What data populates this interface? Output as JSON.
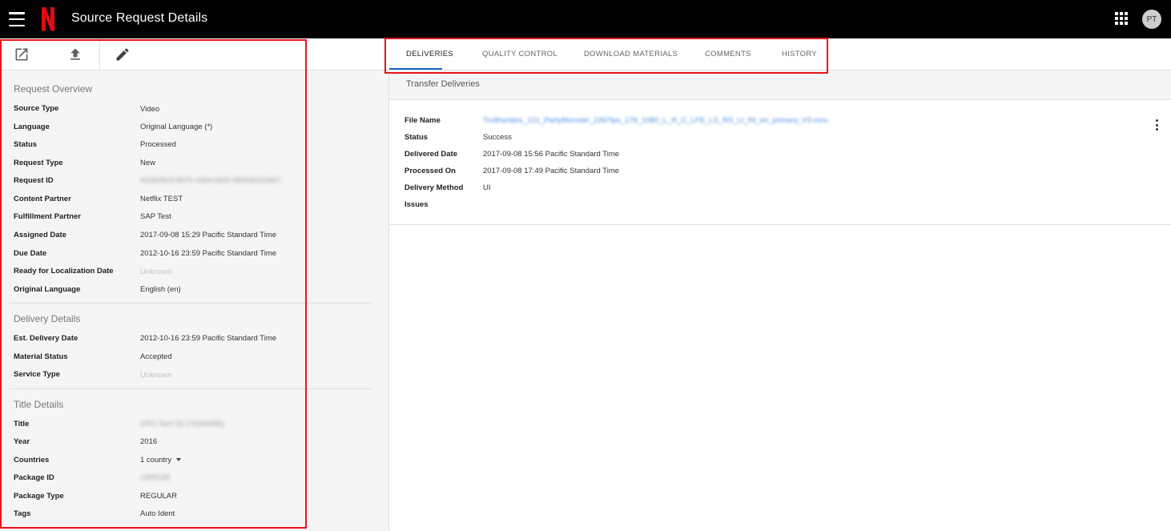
{
  "header": {
    "title": "Source Request Details",
    "avatar_initials": "PT",
    "brand_color": "#e50914",
    "menu_icon": "hamburger-menu-icon",
    "apps_icon": "apps-grid-icon"
  },
  "toolbar": {
    "icons": [
      "open-in-new-icon",
      "upload-icon",
      "edit-pencil-icon"
    ]
  },
  "request_overview": {
    "title": "Request Overview",
    "fields": [
      {
        "label": "Source Type",
        "value": "Video"
      },
      {
        "label": "Language",
        "value": "Original Language (*)"
      },
      {
        "label": "Status",
        "value": "Processed"
      },
      {
        "label": "Request Type",
        "value": "New"
      },
      {
        "label": "Request ID",
        "value": "415628c5-6670-436e-bfc5-0830d521fa57"
      },
      {
        "label": "Content Partner",
        "value": "Netflix TEST"
      },
      {
        "label": "Fulfillment Partner",
        "value": "SAP Test"
      },
      {
        "label": "Assigned Date",
        "value": "2017-09-08 15:29 Pacific Standard Time"
      },
      {
        "label": "Due Date",
        "value": "2012-10-16 23:59 Pacific Standard Time"
      },
      {
        "label": "Ready for Localization Date",
        "value": "Unknown"
      },
      {
        "label": "Original Language",
        "value": "English (en)"
      }
    ]
  },
  "delivery_details": {
    "title": "Delivery Details",
    "fields": [
      {
        "label": "Est. Delivery Date",
        "value": "2012-10-16 23:59 Pacific Standard Time"
      },
      {
        "label": "Material Status",
        "value": "Accepted"
      },
      {
        "label": "Service Type",
        "value": "Unknown"
      }
    ]
  },
  "title_details": {
    "title": "Title Details",
    "fields": [
      {
        "label": "Title",
        "value": "CPO Test 15 (70264086)"
      },
      {
        "label": "Year",
        "value": "2016"
      },
      {
        "label": "Countries",
        "value": "1 country"
      },
      {
        "label": "Package ID",
        "value": "1395136"
      },
      {
        "label": "Package Type",
        "value": "REGULAR"
      },
      {
        "label": "Tags",
        "value": "Auto Ident"
      }
    ]
  },
  "tabs": [
    {
      "label": "DELIVERIES",
      "active": true
    },
    {
      "label": "QUALITY CONTROL",
      "active": false
    },
    {
      "label": "DOWNLOAD MATERIALS",
      "active": false
    },
    {
      "label": "COMMENTS",
      "active": false
    },
    {
      "label": "HISTORY",
      "active": false
    }
  ],
  "transfer_deliveries": {
    "title": "Transfer Deliveries",
    "fields": [
      {
        "label": "File Name",
        "value": "Trollhunters_121_PartyMonster_2397fps_178_1080_L_R_C_LFE_LS_RS_Lt_Rt_en_primary_V3.mov"
      },
      {
        "label": "Status",
        "value": "Success"
      },
      {
        "label": "Delivered Date",
        "value": "2017-09-08 15:56 Pacific Standard Time"
      },
      {
        "label": "Processed On",
        "value": "2017-09-08 17:49 Pacific Standard Time"
      },
      {
        "label": "Delivery Method",
        "value": "UI"
      },
      {
        "label": "Issues",
        "value": ""
      }
    ],
    "row_menu_icon": "more-vertical-icon"
  },
  "colors": {
    "highlight": "#e8141c",
    "active_tab": "#1565c0",
    "link": "#4a90e2"
  }
}
